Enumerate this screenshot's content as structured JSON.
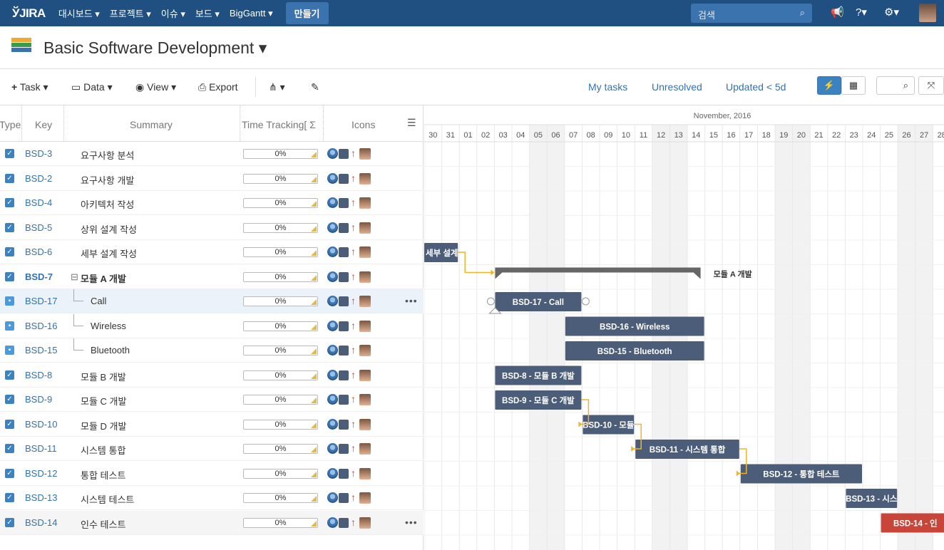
{
  "topnav": {
    "logo": "ЎJIRA",
    "items": [
      "대시보드 ▾",
      "프로젝트 ▾",
      "이슈 ▾",
      "보드 ▾",
      "BigGantt ▾"
    ],
    "create_label": "만들기",
    "search_placeholder": "검색"
  },
  "project": {
    "title": "Basic Software Development ▾"
  },
  "toolbar": {
    "task_label": "Task ▾",
    "data_label": "Data ▾",
    "view_label": "View ▾",
    "export_label": "Export",
    "filters": [
      "My tasks",
      "Unresolved",
      "Updated < 5d"
    ]
  },
  "grid": {
    "headers": {
      "type": "Type",
      "key": "Key",
      "summary": "Summary",
      "time": "Time Tracking[ Σ",
      "icons": "Icons"
    },
    "rows": [
      {
        "key": "BSD-3",
        "summary": "요구사항 분석",
        "progress": "0%",
        "kind": "task"
      },
      {
        "key": "BSD-2",
        "summary": "요구사항 개발",
        "progress": "0%",
        "kind": "task"
      },
      {
        "key": "BSD-4",
        "summary": "아키텍처 작성",
        "progress": "0%",
        "kind": "task"
      },
      {
        "key": "BSD-5",
        "summary": "상위 설계 작성",
        "progress": "0%",
        "kind": "task"
      },
      {
        "key": "BSD-6",
        "summary": "세부 설계 작성",
        "progress": "0%",
        "kind": "task"
      },
      {
        "key": "BSD-7",
        "summary": "모듈 A 개발",
        "progress": "0%",
        "kind": "parent"
      },
      {
        "key": "BSD-17",
        "summary": "Call",
        "progress": "0%",
        "kind": "subtask",
        "highlight": true
      },
      {
        "key": "BSD-16",
        "summary": "Wireless",
        "progress": "0%",
        "kind": "subtask"
      },
      {
        "key": "BSD-15",
        "summary": "Bluetooth",
        "progress": "0%",
        "kind": "subtask"
      },
      {
        "key": "BSD-8",
        "summary": "모듈 B 개발",
        "progress": "0%",
        "kind": "task"
      },
      {
        "key": "BSD-9",
        "summary": "모듈 C 개발",
        "progress": "0%",
        "kind": "task"
      },
      {
        "key": "BSD-10",
        "summary": "모듈 D 개발",
        "progress": "0%",
        "kind": "task"
      },
      {
        "key": "BSD-11",
        "summary": "시스템 통합",
        "progress": "0%",
        "kind": "task"
      },
      {
        "key": "BSD-12",
        "summary": "통합 테스트",
        "progress": "0%",
        "kind": "task"
      },
      {
        "key": "BSD-13",
        "summary": "시스템 테스트",
        "progress": "0%",
        "kind": "task"
      },
      {
        "key": "BSD-14",
        "summary": "인수 테스트",
        "progress": "0%",
        "kind": "task",
        "gray": true
      }
    ]
  },
  "gantt": {
    "month_label": "November, 2016",
    "days": [
      "30",
      "31",
      "01",
      "02",
      "03",
      "04",
      "05",
      "06",
      "07",
      "08",
      "09",
      "10",
      "11",
      "12",
      "13",
      "14",
      "15",
      "16",
      "17",
      "18",
      "19",
      "20",
      "21",
      "22",
      "23",
      "24",
      "25",
      "26",
      "27",
      "28"
    ],
    "weekend_days": [
      "05",
      "06",
      "12",
      "13",
      "19",
      "20",
      "26",
      "27"
    ],
    "bars": [
      {
        "row": 4,
        "start": "30",
        "end": "31",
        "label": "세부 설계",
        "color": "#4c5d7a",
        "clip_left": true
      },
      {
        "row": 6,
        "start": "03",
        "end": "07",
        "label": "BSD-17 - Call",
        "color": "#4c5d7a",
        "selected": true
      },
      {
        "row": 7,
        "start": "07",
        "end": "14",
        "label": "BSD-16 - Wireless",
        "color": "#4c5d7a"
      },
      {
        "row": 8,
        "start": "07",
        "end": "14",
        "label": "BSD-15 - Bluetooth",
        "color": "#4c5d7a"
      },
      {
        "row": 9,
        "start": "03",
        "end": "07",
        "label": "BSD-8 - 모듈 B 개발",
        "color": "#4c5d7a"
      },
      {
        "row": 10,
        "start": "03",
        "end": "07",
        "label": "BSD-9 - 모듈 C 개발",
        "color": "#4c5d7a"
      },
      {
        "row": 11,
        "start": "08",
        "end": "10",
        "label": "BSD-10 - 모듈",
        "color": "#4c5d7a"
      },
      {
        "row": 12,
        "start": "11",
        "end": "16",
        "label": "BSD-11 - 시스템 통합",
        "color": "#4c5d7a"
      },
      {
        "row": 13,
        "start": "17",
        "end": "23",
        "label": "BSD-12 - 통합 테스트",
        "color": "#4c5d7a"
      },
      {
        "row": 14,
        "start": "23",
        "end": "25",
        "label": "BSD-13 - 시스",
        "color": "#4c5d7a"
      },
      {
        "row": 15,
        "start": "25",
        "end": "28",
        "label": "BSD-14 - 인",
        "color": "#c8453a"
      }
    ],
    "summary_bar": {
      "row": 5,
      "start": "03",
      "end": "14",
      "label": "모듈 A 개발",
      "color": "#666666"
    },
    "links": [
      [
        4,
        5
      ],
      [
        10,
        11
      ],
      [
        11,
        12
      ],
      [
        12,
        13
      ]
    ]
  }
}
